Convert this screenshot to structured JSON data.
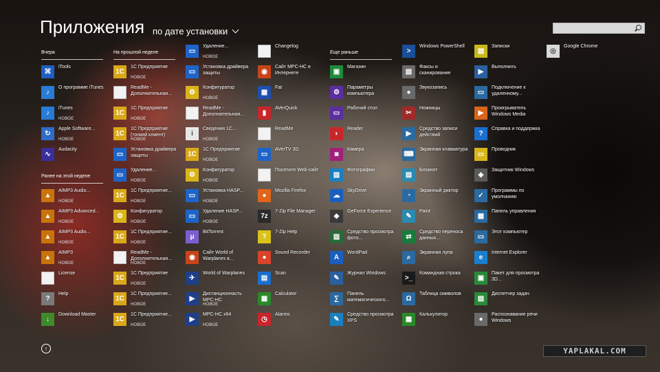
{
  "header": {
    "title": "Приложения",
    "sort_label": "по дате установки"
  },
  "search": {
    "placeholder": ""
  },
  "watermark": "YAPLAKAL.COM",
  "groups": [
    {
      "label": "Вчера"
    },
    {
      "label": "На прошлой неделе"
    },
    {
      "label": "Ранее на этой неделе"
    },
    {
      "label": "Еще раньше"
    }
  ],
  "apps": [
    {
      "name": "iTools",
      "new": "",
      "icon": "itools-icon",
      "color": "#1f5fbf"
    },
    {
      "name": "О программе iTunes",
      "new": "",
      "icon": "itunes-icon",
      "color": "#2a7bd6"
    },
    {
      "name": "iTunes",
      "new": "НОВОЕ",
      "icon": "itunes-icon",
      "color": "#2a7bd6"
    },
    {
      "name": "Apple Software...",
      "new": "НОВОЕ",
      "icon": "apple-update-icon",
      "color": "#2f6cc8"
    },
    {
      "name": "Audacity",
      "new": "",
      "icon": "audacity-icon",
      "color": "#3a2f9a"
    },
    {
      "name": "AIMP3 Audio...",
      "new": "НОВОЕ",
      "icon": "aimp-icon",
      "color": "#c8740a"
    },
    {
      "name": "AIMP3 Advanced...",
      "new": "НОВОЕ",
      "icon": "aimp-icon",
      "color": "#c8740a"
    },
    {
      "name": "AIMP3 Audio...",
      "new": "НОВОЕ",
      "icon": "aimp-icon",
      "color": "#c8740a"
    },
    {
      "name": "AIMP3",
      "new": "НОВОЕ",
      "icon": "aimp-icon",
      "color": "#c8740a"
    },
    {
      "name": "License",
      "new": "",
      "icon": "document-icon",
      "color": "#f2f2f2"
    },
    {
      "name": "Help",
      "new": "",
      "icon": "help-icon",
      "color": "#7a7a7a"
    },
    {
      "name": "Download Master",
      "new": "",
      "icon": "download-master-icon",
      "color": "#3f8a2a"
    },
    {
      "name": "1С Предприятие",
      "new": "НОВОЕ",
      "icon": "1c-icon",
      "color": "#d9a81a"
    },
    {
      "name": "ReadMe - Дополнительная...",
      "new": "",
      "icon": "document-icon",
      "color": "#f2f2f2"
    },
    {
      "name": "1С Предприятие",
      "new": "НОВОЕ",
      "icon": "1c-icon",
      "color": "#d9a81a"
    },
    {
      "name": "1С Предприятие (тонкий клиент)",
      "new": "НОВОЕ",
      "icon": "1c-icon",
      "color": "#d9a81a"
    },
    {
      "name": "Установка драйвера защиты",
      "new": "",
      "icon": "window-icon",
      "color": "#1e64c8"
    },
    {
      "name": "Удаление...",
      "new": "НОВОЕ",
      "icon": "window-icon",
      "color": "#1e64c8"
    },
    {
      "name": "1С Предприятие...",
      "new": "НОВОЕ",
      "icon": "1c-icon",
      "color": "#d9a81a"
    },
    {
      "name": "Конфигуратор",
      "new": "НОВОЕ",
      "icon": "config-icon",
      "color": "#d9b51a"
    },
    {
      "name": "1С Предприятие...",
      "new": "НОВОЕ",
      "icon": "1c-icon",
      "color": "#d9a81a"
    },
    {
      "name": "ReadMe - Дополнительная...",
      "new": "НОВОЕ",
      "icon": "document-icon",
      "color": "#f2f2f2"
    },
    {
      "name": "1С Предприятие",
      "new": "НОВОЕ",
      "icon": "1c-icon",
      "color": "#d9a81a"
    },
    {
      "name": "1С Предприятие...",
      "new": "НОВОЕ",
      "icon": "1c-icon",
      "color": "#d9a81a"
    },
    {
      "name": "1С Предприятие...",
      "new": "НОВОЕ",
      "icon": "1c-icon",
      "color": "#d9a81a"
    },
    {
      "name": "Удаление...",
      "new": "НОВОЕ",
      "icon": "window-icon",
      "color": "#1e64c8"
    },
    {
      "name": "Установка драйвера защиты",
      "new": "",
      "icon": "window-icon",
      "color": "#1e64c8"
    },
    {
      "name": "Конфигуратор",
      "new": "НОВОЕ",
      "icon": "config-icon",
      "color": "#d9b51a"
    },
    {
      "name": "ReadMe - Дополнительная...",
      "new": "",
      "icon": "document-icon",
      "color": "#f2f2f2"
    },
    {
      "name": "Сведения 1С...",
      "new": "НОВОЕ",
      "icon": "info-1c-icon",
      "color": "#e8e8e8"
    },
    {
      "name": "1С Предприятие",
      "new": "НОВОЕ",
      "icon": "1c-icon",
      "color": "#d9a81a"
    },
    {
      "name": "Конфигуратор",
      "new": "НОВОЕ",
      "icon": "config-icon",
      "color": "#d9b51a"
    },
    {
      "name": "Установка HASP...",
      "new": "НОВОЕ",
      "icon": "window-icon",
      "color": "#1e64c8"
    },
    {
      "name": "Удаление HASP...",
      "new": "НОВОЕ",
      "icon": "window-icon",
      "color": "#1e64c8"
    },
    {
      "name": "BitTorrent",
      "new": "",
      "icon": "bittorrent-icon",
      "color": "#7a5fd0"
    },
    {
      "name": "Сайт World of Warplanes в...",
      "new": "",
      "icon": "web-icon",
      "color": "#c8441a"
    },
    {
      "name": "World of Warplanes",
      "new": "",
      "icon": "warplanes-icon",
      "color": "#1f3f8a"
    },
    {
      "name": "Дистанционнасть MPC-HC",
      "new": "НОВОЕ",
      "icon": "mpc-icon",
      "color": "#1f3f8a"
    },
    {
      "name": "MPC-HC x64",
      "new": "НОВОЕ",
      "icon": "mpc-icon",
      "color": "#1f3f8a"
    },
    {
      "name": "Changelog",
      "new": "",
      "icon": "document-icon",
      "color": "#f2f2f2"
    },
    {
      "name": "Сайт MPC-HC в Интернете",
      "new": "",
      "icon": "web-icon",
      "color": "#c8441a"
    },
    {
      "name": "Fat",
      "new": "",
      "icon": "fat-icon",
      "color": "#1f4fb0"
    },
    {
      "name": "AVerQuick",
      "new": "",
      "icon": "averquick-icon",
      "color": "#c8262a"
    },
    {
      "name": "ReadMe",
      "new": "",
      "icon": "document-icon",
      "color": "#f2f2f2"
    },
    {
      "name": "AVerTV 3D",
      "new": "",
      "icon": "avertv-icon",
      "color": "#1e64c8"
    },
    {
      "name": "Посетите Web-сайт",
      "new": "",
      "icon": "document-icon",
      "color": "#f2f2f2"
    },
    {
      "name": "Mozilla Firefox",
      "new": "",
      "icon": "firefox-icon",
      "color": "#e0641a"
    },
    {
      "name": "7-Zip File Manager",
      "new": "",
      "icon": "7zip-icon",
      "color": "#2a2a2a"
    },
    {
      "name": "7-Zip Help",
      "new": "",
      "icon": "help-icon",
      "color": "#d9c21a"
    },
    {
      "name": "Sound Recorder",
      "new": "",
      "icon": "microphone-icon",
      "color": "#d9442a"
    },
    {
      "name": "Scan",
      "new": "",
      "icon": "scan-icon",
      "color": "#1a6fcf"
    },
    {
      "name": "Calculator",
      "new": "",
      "icon": "calculator-icon",
      "color": "#2a8a2a"
    },
    {
      "name": "Alarms",
      "new": "",
      "icon": "alarm-icon",
      "color": "#c8262a"
    },
    {
      "name": "Магазин",
      "new": "",
      "icon": "store-icon",
      "color": "#1f8a3a"
    },
    {
      "name": "Параметры компьютера",
      "new": "",
      "icon": "gear-icon",
      "color": "#5a2fa0"
    },
    {
      "name": "Рабочий стол",
      "new": "",
      "icon": "desktop-icon",
      "color": "#5a2fa0"
    },
    {
      "name": "Reader",
      "new": "",
      "icon": "reader-icon",
      "color": "#c8262a"
    },
    {
      "name": "Камера",
      "new": "",
      "icon": "camera-icon",
      "color": "#a0207a"
    },
    {
      "name": "Фотографии",
      "new": "",
      "icon": "photos-icon",
      "color": "#1a7fbf"
    },
    {
      "name": "SkyDrive",
      "new": "",
      "icon": "skydrive-icon",
      "color": "#1a5fbf"
    },
    {
      "name": "GeForce Experience",
      "new": "",
      "icon": "geforce-icon",
      "color": "#3a3a3a"
    },
    {
      "name": "Средство просмотра фото...",
      "new": "",
      "icon": "photo-viewer-icon",
      "color": "#2a6a3a"
    },
    {
      "name": "WordPad",
      "new": "",
      "icon": "wordpad-icon",
      "color": "#1a5fbf"
    },
    {
      "name": "Журнал Windows",
      "new": "",
      "icon": "journal-icon",
      "color": "#2a5fa0"
    },
    {
      "name": "Панель математического...",
      "new": "",
      "icon": "math-panel-icon",
      "color": "#2a6aa0"
    },
    {
      "name": "Средство просмотра XPS",
      "new": "",
      "icon": "xps-icon",
      "color": "#1a7fbf"
    },
    {
      "name": "Windows PowerShell",
      "new": "",
      "icon": "powershell-icon",
      "color": "#1a4f9a"
    },
    {
      "name": "Факсы и сканирование",
      "new": "",
      "icon": "fax-icon",
      "color": "#6a6a6a"
    },
    {
      "name": "Звукозапись",
      "new": "",
      "icon": "recorder-icon",
      "color": "#6a6a6a"
    },
    {
      "name": "Ножницы",
      "new": "",
      "icon": "snipping-icon",
      "color": "#a02a2a"
    },
    {
      "name": "Средство записи действий",
      "new": "",
      "icon": "steps-icon",
      "color": "#2a6aa0"
    },
    {
      "name": "Экранная клавиатура",
      "new": "",
      "icon": "keyboard-icon",
      "color": "#2a6aa0"
    },
    {
      "name": "Блокнот",
      "new": "",
      "icon": "notepad-icon",
      "color": "#2a8ab0"
    },
    {
      "name": "Экранный диктор",
      "new": "",
      "icon": "narrator-icon",
      "color": "#2a6aa0"
    },
    {
      "name": "Paint",
      "new": "",
      "icon": "paint-icon",
      "color": "#2a8ab0"
    },
    {
      "name": "Средство переноса данных...",
      "new": "",
      "icon": "transfer-icon",
      "color": "#1a7a3a"
    },
    {
      "name": "Экранная лупа",
      "new": "",
      "icon": "magnifier-icon",
      "color": "#2a6aa0"
    },
    {
      "name": "Командная строка",
      "new": "",
      "icon": "cmd-icon",
      "color": "#1a1a1a"
    },
    {
      "name": "Таблица символов",
      "new": "",
      "icon": "charmap-icon",
      "color": "#2a6aa0"
    },
    {
      "name": "Калькулятор",
      "new": "",
      "icon": "calculator-icon",
      "color": "#2a8a2a"
    },
    {
      "name": "Записки",
      "new": "",
      "icon": "sticky-notes-icon",
      "color": "#c8b81a"
    },
    {
      "name": "Выполнить",
      "new": "",
      "icon": "run-icon",
      "color": "#2a5fa0"
    },
    {
      "name": "Подключение к удаленному...",
      "new": "",
      "icon": "remote-desktop-icon",
      "color": "#2a6aa0"
    },
    {
      "name": "Проигрыватель Windows Media",
      "new": "",
      "icon": "media-player-icon",
      "color": "#d9641a"
    },
    {
      "name": "Справка и поддержка",
      "new": "",
      "icon": "help-icon",
      "color": "#1a6fcf"
    },
    {
      "name": "Проводник",
      "new": "",
      "icon": "explorer-icon",
      "color": "#d9b51a"
    },
    {
      "name": "Защитник Windows",
      "new": "",
      "icon": "defender-icon",
      "color": "#5a5a5a"
    },
    {
      "name": "Программы по умолчанию",
      "new": "",
      "icon": "default-programs-icon",
      "color": "#2a6aa0"
    },
    {
      "name": "Панель управления",
      "new": "",
      "icon": "control-panel-icon",
      "color": "#2a6aa0"
    },
    {
      "name": "Этот компьютер",
      "new": "",
      "icon": "computer-icon",
      "color": "#2a6aa0"
    },
    {
      "name": "Internet Explorer",
      "new": "",
      "icon": "ie-icon",
      "color": "#1a7fcf"
    },
    {
      "name": "Пакет для просмотра 3D...",
      "new": "",
      "icon": "3d-viewer-icon",
      "color": "#2a8a3a"
    },
    {
      "name": "Диспетчер задач",
      "new": "",
      "icon": "task-manager-icon",
      "color": "#2a8a3a"
    },
    {
      "name": "Распознавание речи Windows",
      "new": "",
      "icon": "speech-icon",
      "color": "#6a6a6a"
    },
    {
      "name": "Google Chrome",
      "new": "",
      "icon": "chrome-icon",
      "color": "#d9d9d9"
    }
  ]
}
